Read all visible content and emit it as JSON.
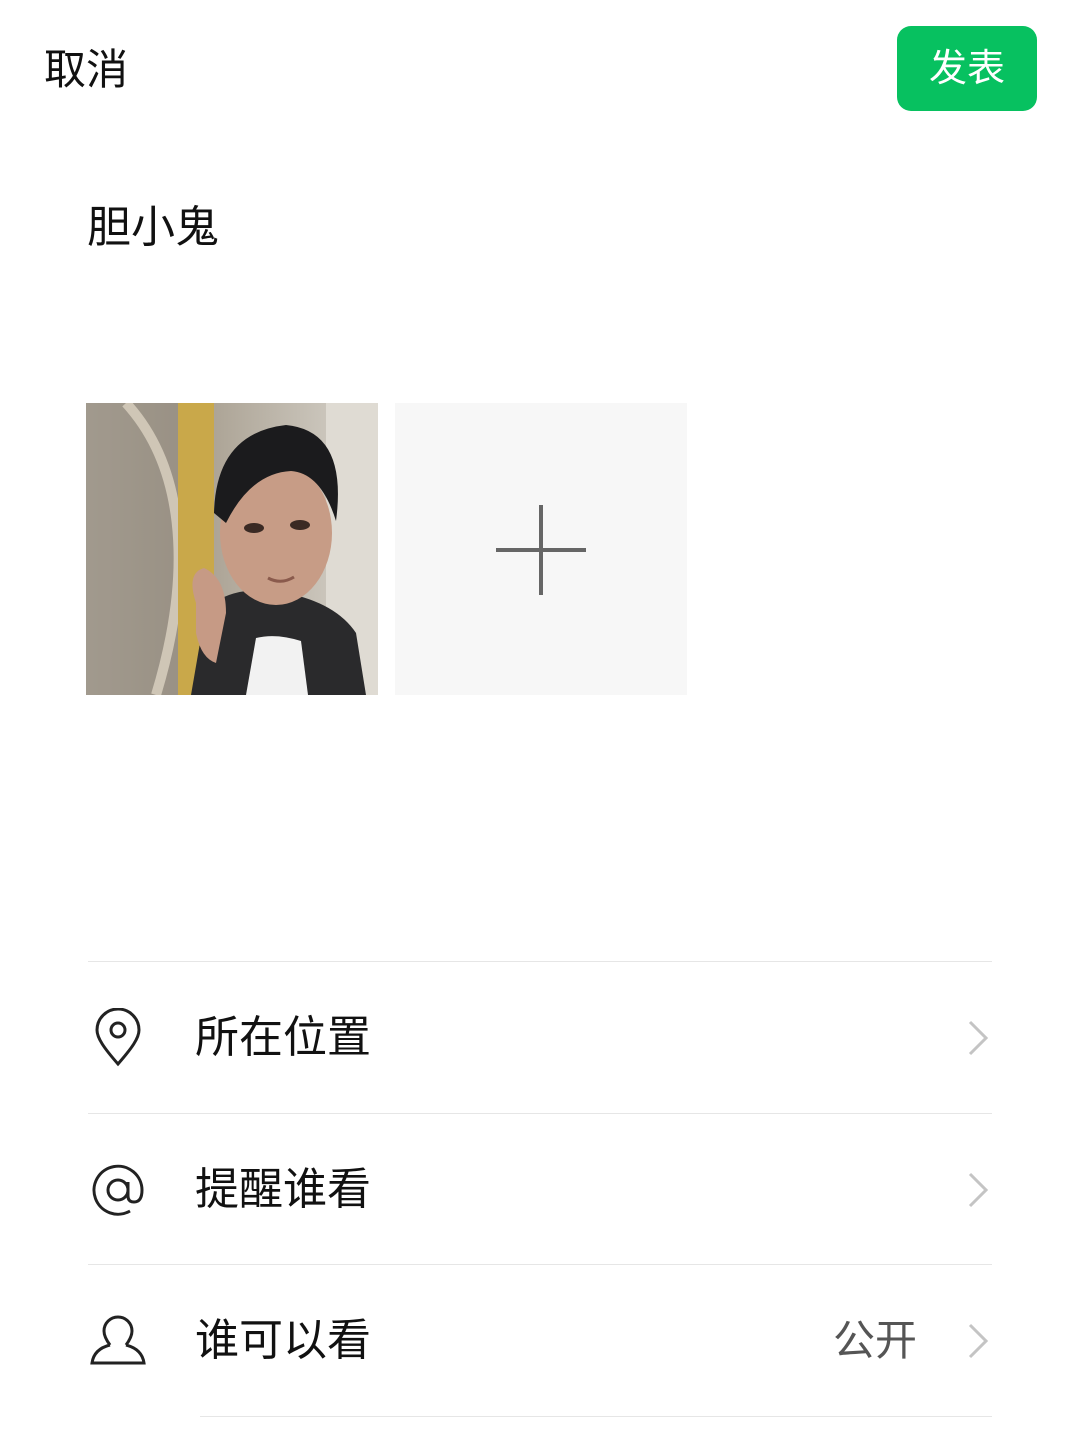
{
  "header": {
    "cancel_label": "取消",
    "publish_label": "发表",
    "publish_color": "#07c160"
  },
  "post": {
    "text": "胆小鬼"
  },
  "media": {
    "photos": [
      {
        "icon": "photo-thumbnail"
      }
    ],
    "add_icon": "plus-icon"
  },
  "options": [
    {
      "icon": "location-pin-icon",
      "label": "所在位置",
      "value": ""
    },
    {
      "icon": "at-sign-icon",
      "label": "提醒谁看",
      "value": ""
    },
    {
      "icon": "person-icon",
      "label": "谁可以看",
      "value": "公开"
    }
  ]
}
